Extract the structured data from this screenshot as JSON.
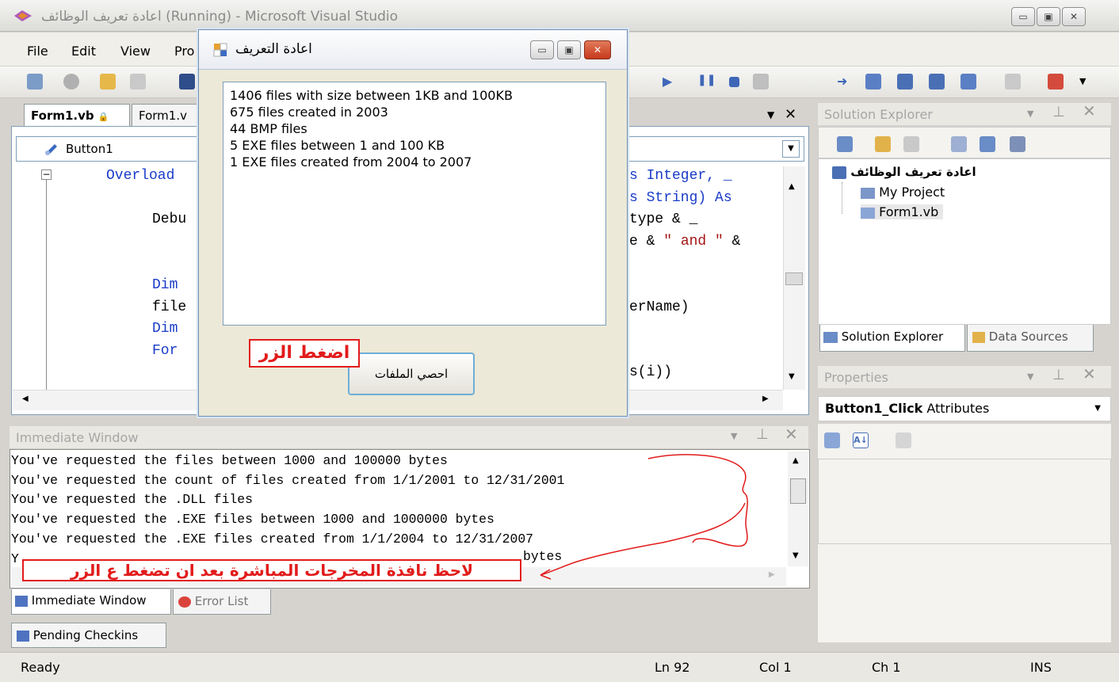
{
  "window": {
    "title": "اعادة تعريف الوظائف (Running) - Microsoft Visual Studio",
    "buttons": [
      "minimize",
      "maximize",
      "close"
    ]
  },
  "menu": [
    "File",
    "Edit",
    "View",
    "Pro"
  ],
  "doc_tabs": [
    {
      "label": "Form1.vb",
      "active": true
    },
    {
      "label": "Form1.v",
      "active": false
    }
  ],
  "editor": {
    "object_combo": "Button1",
    "lines": [
      {
        "parts": [
          {
            "t": "Overload",
            "c": "kw"
          }
        ],
        "right": [
          {
            "t": "s Integer, _",
            "c": "kw"
          }
        ]
      },
      {
        "parts": [],
        "right": [
          {
            "t": "s String) As",
            "c": "kw"
          }
        ]
      },
      {
        "parts": [
          {
            "t": "Debu",
            "c": ""
          }
        ],
        "right": [
          {
            "t": "type & _",
            "c": ""
          }
        ]
      },
      {
        "parts": [],
        "right": [
          {
            "t": "e & ",
            "c": ""
          },
          {
            "t": "\" and \"",
            "c": "str"
          },
          {
            "t": " &",
            "c": ""
          }
        ]
      },
      {
        "parts": [],
        "right": []
      },
      {
        "parts": [
          {
            "t": "Dim",
            "c": "kw"
          }
        ],
        "right": []
      },
      {
        "parts": [
          {
            "t": "file",
            "c": ""
          }
        ],
        "right": [
          {
            "t": "erName)",
            "c": ""
          }
        ]
      },
      {
        "parts": [
          {
            "t": "Dim",
            "c": "kw"
          }
        ],
        "right": []
      },
      {
        "parts": [
          {
            "t": "For",
            "c": "kw"
          }
        ],
        "right": []
      },
      {
        "parts": [],
        "right": [
          {
            "t": "s(i))",
            "c": ""
          }
        ]
      }
    ]
  },
  "dialog": {
    "title": "اعادة التعريف",
    "results": [
      "1406 files with size between 1KB and 100KB",
      "675 files created in 2003",
      "44 BMP files",
      "5 EXE files between 1 and 100 KB",
      "1 EXE files created from 2004 to 2007"
    ],
    "button_label": "احصي الملفات",
    "annotation": "اضغط الزر"
  },
  "solution_explorer": {
    "title": "Solution Explorer",
    "project": "اعادة تعريف الوظائف",
    "items": [
      "My Project",
      "Form1.vb"
    ],
    "tabs": [
      "Solution Explorer",
      "Data Sources"
    ]
  },
  "properties": {
    "title": "Properties",
    "object": "Button1_Click",
    "object_type": "Attributes"
  },
  "immediate": {
    "title": "Immediate Window",
    "lines": [
      "You've requested the files between 1000 and 100000 bytes",
      "You've requested the count of files created from 1/1/2001 to 12/31/2001",
      "You've requested the .DLL files",
      "You've requested the .EXE files between 1000 and 1000000 bytes",
      "You've requested the .EXE files created from 1/1/2004 to 12/31/2007"
    ],
    "partial_line": "Y",
    "partial_tail": "bytes",
    "annotation": "لاحظ نافذة المخرجات المباشرة بعد ان تضغط ع الزر",
    "tabs": [
      "Immediate Window",
      "Error List"
    ],
    "pending": "Pending Checkins"
  },
  "status": {
    "ready": "Ready",
    "ln": "Ln 92",
    "col": "Col 1",
    "ch": "Ch 1",
    "ins": "INS"
  },
  "colors": {
    "accent_blue": "#1a3cc8",
    "annotation_red": "#e21b1b",
    "string_red": "#a31515"
  }
}
